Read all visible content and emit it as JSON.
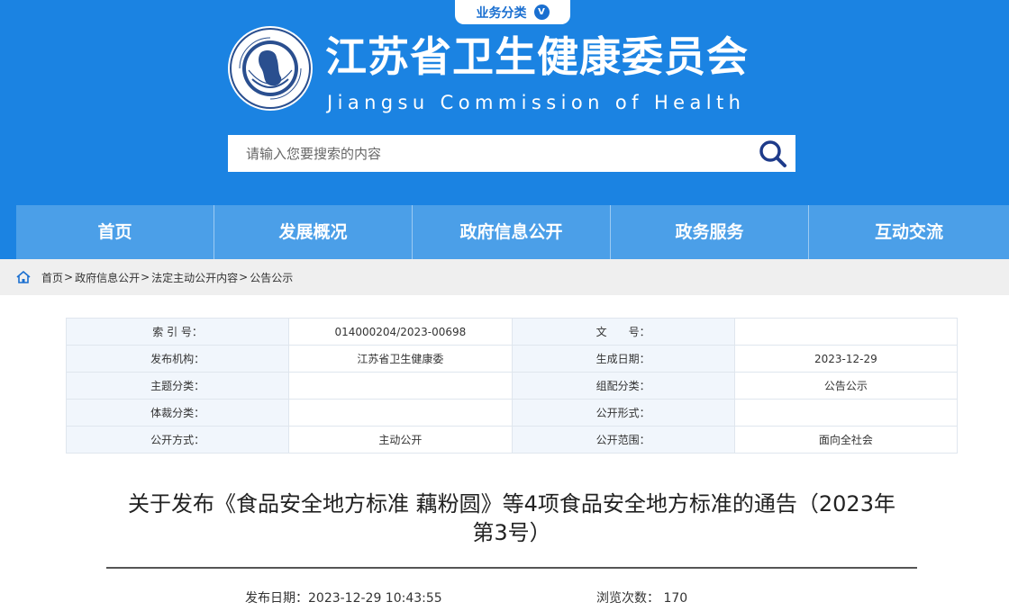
{
  "header": {
    "biz_tab_label": "业务分类",
    "site_title": "江苏省卫生健康委员会",
    "site_subtitle": "Jiangsu Commission of Health",
    "logo_text": "Jiangsu Commission of Health",
    "search_placeholder": "请输入您要搜索的内容"
  },
  "nav": [
    "首页",
    "发展概况",
    "政府信息公开",
    "政务服务",
    "互动交流"
  ],
  "breadcrumb": [
    "首页",
    "政府信息公开",
    "法定主动公开内容",
    "公告公示"
  ],
  "breadcrumb_sep": ">",
  "meta": [
    [
      {
        "k": "索 引 号：",
        "v": "014000204/2023-00698"
      },
      {
        "k": "文　　号：",
        "v": ""
      }
    ],
    [
      {
        "k": "发布机构：",
        "v": "江苏省卫生健康委"
      },
      {
        "k": "生成日期：",
        "v": "2023-12-29"
      }
    ],
    [
      {
        "k": "主题分类：",
        "v": ""
      },
      {
        "k": "组配分类：",
        "v": "公告公示"
      }
    ],
    [
      {
        "k": "体裁分类：",
        "v": ""
      },
      {
        "k": "公开形式：",
        "v": ""
      }
    ],
    [
      {
        "k": "公开方式：",
        "v": "主动公开"
      },
      {
        "k": "公开范围：",
        "v": "面向全社会"
      }
    ]
  ],
  "article": {
    "title_line1": "关于发布《食品安全地方标准 藕粉圆》等4项食品安全地方标准的通告（2023年",
    "title_line2": "第3号）",
    "pub_date_label": "发布日期：",
    "pub_date": "2023-12-29 10:43:55",
    "views_label": "浏览次数：",
    "views": "170"
  },
  "colors": {
    "header_bg": "#1b83e2",
    "nav_bg": "#4b9fe8",
    "accent": "#1a6fd0"
  },
  "icons": {
    "search": "search-icon",
    "home": "home-icon",
    "chevron": "chevron-down-icon",
    "logo": "emblem-logo"
  }
}
